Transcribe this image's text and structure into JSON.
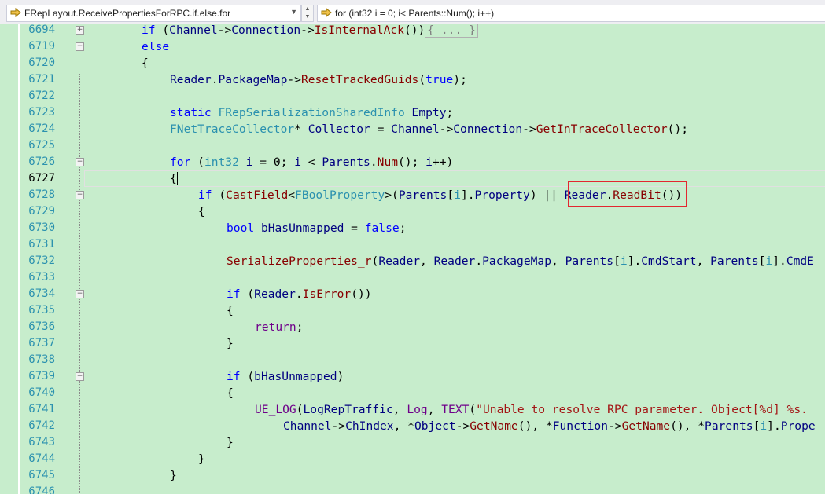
{
  "navbar": {
    "scope": "FRepLayout.ReceivePropertiesForRPC.if.else.for",
    "member": "for (int32 i = 0; i< Parents::Num(); i++)",
    "scope_icon": "arrow-right-icon",
    "member_icon": "arrow-right-icon"
  },
  "editor": {
    "current_line": "6727",
    "collapsed_block": "{ ... }",
    "lines": [
      {
        "num": "6694"
      },
      {
        "num": "6719"
      },
      {
        "num": "6720"
      },
      {
        "num": "6721"
      },
      {
        "num": "6722"
      },
      {
        "num": "6723"
      },
      {
        "num": "6724"
      },
      {
        "num": "6725"
      },
      {
        "num": "6726"
      },
      {
        "num": "6727"
      },
      {
        "num": "6728"
      },
      {
        "num": "6729"
      },
      {
        "num": "6730"
      },
      {
        "num": "6731"
      },
      {
        "num": "6732"
      },
      {
        "num": "6733"
      },
      {
        "num": "6734"
      },
      {
        "num": "6735"
      },
      {
        "num": "6736"
      },
      {
        "num": "6737"
      },
      {
        "num": "6738"
      },
      {
        "num": "6739"
      },
      {
        "num": "6740"
      },
      {
        "num": "6741"
      },
      {
        "num": "6742"
      },
      {
        "num": "6743"
      },
      {
        "num": "6744"
      },
      {
        "num": "6745"
      },
      {
        "num": "6746"
      }
    ]
  },
  "colors": {
    "background": "#c7edcc",
    "keyword": "#0000ff",
    "type": "#2b91af",
    "function": "#880000",
    "string": "#a31515",
    "highlight_box": "#e3262f"
  }
}
